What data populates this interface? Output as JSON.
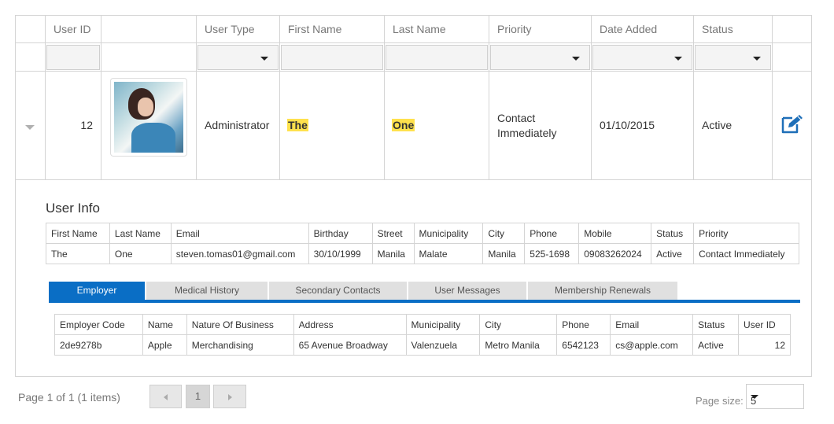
{
  "grid": {
    "headers": {
      "user_id": "User ID",
      "user_type": "User Type",
      "first_name": "First Name",
      "last_name": "Last Name",
      "priority": "Priority",
      "date_added": "Date Added",
      "status": "Status"
    },
    "row": {
      "user_id": "12",
      "user_type": "Administrator",
      "first_name": "The",
      "last_name": "One",
      "priority_line1": "Contact",
      "priority_line2": "Immediately",
      "date_added": "01/10/2015",
      "status": "Active"
    }
  },
  "user_info": {
    "title": "User Info",
    "headers": [
      "First Name",
      "Last Name",
      "Email",
      "Birthday",
      "Street",
      "Municipality",
      "City",
      "Phone",
      "Mobile",
      "Status",
      "Priority"
    ],
    "values": [
      "The",
      "One",
      "steven.tomas01@gmail.com",
      "30/10/1999",
      "Manila",
      "Malate",
      "Manila",
      "525-1698",
      "09083262024",
      "Active",
      "Contact Immediately"
    ]
  },
  "tabs": [
    "Employer",
    "Medical History",
    "Secondary Contacts",
    "User Messages",
    "Membership Renewals"
  ],
  "employer": {
    "headers": [
      "Employer Code",
      "Name",
      "Nature Of Business",
      "Address",
      "Municipality",
      "City",
      "Phone",
      "Email",
      "Status",
      "User ID"
    ],
    "values": [
      "2de9278b",
      "Apple",
      "Merchandising",
      "65 Avenue Broadway",
      "Valenzuela",
      "Metro Manila",
      "6542123",
      "cs@apple.com",
      "Active",
      "12"
    ]
  },
  "pager": {
    "info": "Page 1 of 1 (1 items)",
    "current_page": "1",
    "page_size_label": "Page size:",
    "page_size_value": "5"
  },
  "colors": {
    "accent": "#0a6ec5",
    "highlight": "#ffe14d",
    "edit_icon": "#1f6fb8"
  },
  "icons": [
    "chevron-down-icon",
    "edit-icon",
    "arrow-left-icon",
    "arrow-right-icon"
  ]
}
